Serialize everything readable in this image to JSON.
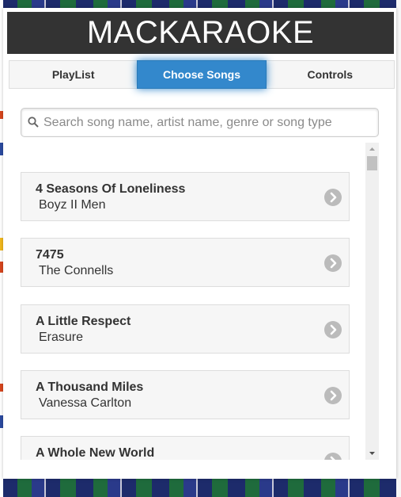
{
  "app": {
    "title": "MACKARAOKE"
  },
  "tabs": [
    {
      "label": "PlayList",
      "active": false
    },
    {
      "label": "Choose Songs",
      "active": true
    },
    {
      "label": "Controls",
      "active": false
    }
  ],
  "search": {
    "value": "",
    "placeholder": "Search song name, artist name, genre or song type"
  },
  "songs": [
    {
      "title": "4 Seasons Of Loneliness",
      "artist": "Boyz II Men"
    },
    {
      "title": "7475",
      "artist": "The Connells"
    },
    {
      "title": "A Little Respect",
      "artist": "Erasure"
    },
    {
      "title": "A Thousand Miles",
      "artist": "Vanessa Carlton"
    },
    {
      "title": "A Whole New World",
      "artist": ""
    }
  ],
  "colors": {
    "header_bg": "#333333",
    "accent": "#3388cc",
    "item_bg": "#f6f6f6",
    "arrow_bg": "#bbbbbb"
  },
  "icons": {
    "search": "search-icon",
    "item_arrow": "chevron-right-icon",
    "scroll_up": "scroll-up-arrow-icon",
    "scroll_down": "scroll-down-arrow-icon"
  }
}
